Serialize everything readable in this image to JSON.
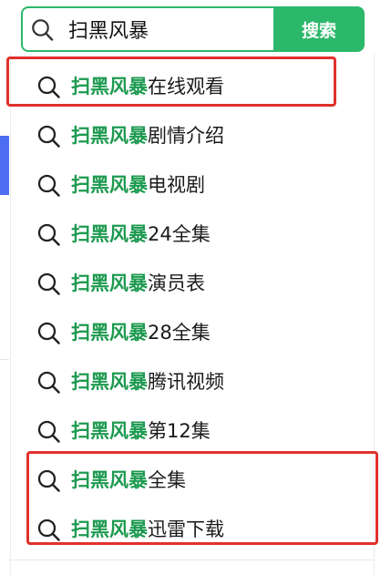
{
  "search": {
    "query": "扫黑风暴",
    "button_label": "搜索"
  },
  "suggestions": [
    {
      "highlight": "扫黑风暴",
      "suffix": "在线观看"
    },
    {
      "highlight": "扫黑风暴",
      "suffix": "剧情介绍"
    },
    {
      "highlight": "扫黑风暴",
      "suffix": "电视剧"
    },
    {
      "highlight": "扫黑风暴",
      "suffix": "24全集"
    },
    {
      "highlight": "扫黑风暴",
      "suffix": "演员表"
    },
    {
      "highlight": "扫黑风暴",
      "suffix": "28全集"
    },
    {
      "highlight": "扫黑风暴",
      "suffix": "腾讯视频"
    },
    {
      "highlight": "扫黑风暴",
      "suffix": "第12集"
    },
    {
      "highlight": "扫黑风暴",
      "suffix": "全集"
    },
    {
      "highlight": "扫黑风暴",
      "suffix": "迅雷下载"
    }
  ],
  "icons": {
    "search": "search-icon",
    "suggestion": "search-icon"
  },
  "colors": {
    "accent_green": "#2cb86a",
    "highlight_green": "#1d9a50",
    "annotation_red": "#e0312b",
    "side_blue": "#4e6ef2"
  }
}
